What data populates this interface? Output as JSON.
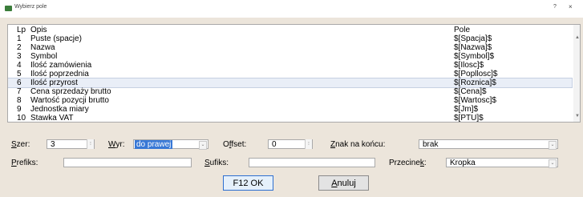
{
  "window": {
    "title": "Wybierz pole",
    "help": "?",
    "close": "×"
  },
  "list": {
    "headers": {
      "lp": "Lp",
      "opis": "Opis",
      "pole": "Pole"
    },
    "rows": [
      {
        "lp": "1",
        "opis": "Puste (spacje)",
        "pole": "$[Spacja]$"
      },
      {
        "lp": "2",
        "opis": "Nazwa",
        "pole": "$[Nazwa]$"
      },
      {
        "lp": "3",
        "opis": "Symbol",
        "pole": "$[Symbol]$"
      },
      {
        "lp": "4",
        "opis": "Ilość zamówienia",
        "pole": "$[Ilosc]$"
      },
      {
        "lp": "5",
        "opis": "Ilość poprzednia",
        "pole": "$[Popllosc]$"
      },
      {
        "lp": "6",
        "opis": "Ilość przyrost",
        "pole": "$[Roznica]$"
      },
      {
        "lp": "7",
        "opis": "Cena sprzedaży brutto",
        "pole": "$[Cena]$"
      },
      {
        "lp": "8",
        "opis": "Wartość pozycji brutto",
        "pole": "$[Wartosc]$"
      },
      {
        "lp": "9",
        "opis": "Jednostka miary",
        "pole": "$[Jm]$"
      },
      {
        "lp": "10",
        "opis": "Stawka VAT",
        "pole": "$[PTU]$"
      }
    ]
  },
  "form": {
    "szer_label_u": "S",
    "szer_label_rest": "zer:",
    "szer_value": "3",
    "wyr_label_u": "W",
    "wyr_label_rest": "yr:",
    "wyr_value": "do prawej",
    "offset_label_pre": "O",
    "offset_label_u": "f",
    "offset_label_rest": "fset:",
    "offset_value": "0",
    "znak_label_u": "Z",
    "znak_label_rest": "nak na końcu:",
    "znak_value": "brak",
    "prefiks_label_u": "P",
    "prefiks_label_rest": "refiks:",
    "prefiks_value": "",
    "sufiks_label_u": "S",
    "sufiks_label_rest": "ufiks:",
    "sufiks_value": "",
    "przecinek_label_pre": "Przecine",
    "przecinek_label_u": "k",
    "przecinek_label_rest": ":",
    "przecinek_value": "Kropka"
  },
  "buttons": {
    "ok": "F12 OK",
    "cancel_u": "A",
    "cancel_rest": "nuluj"
  },
  "icons": {
    "spin": "spin-icon",
    "dropdown": "chevron-down-icon"
  }
}
